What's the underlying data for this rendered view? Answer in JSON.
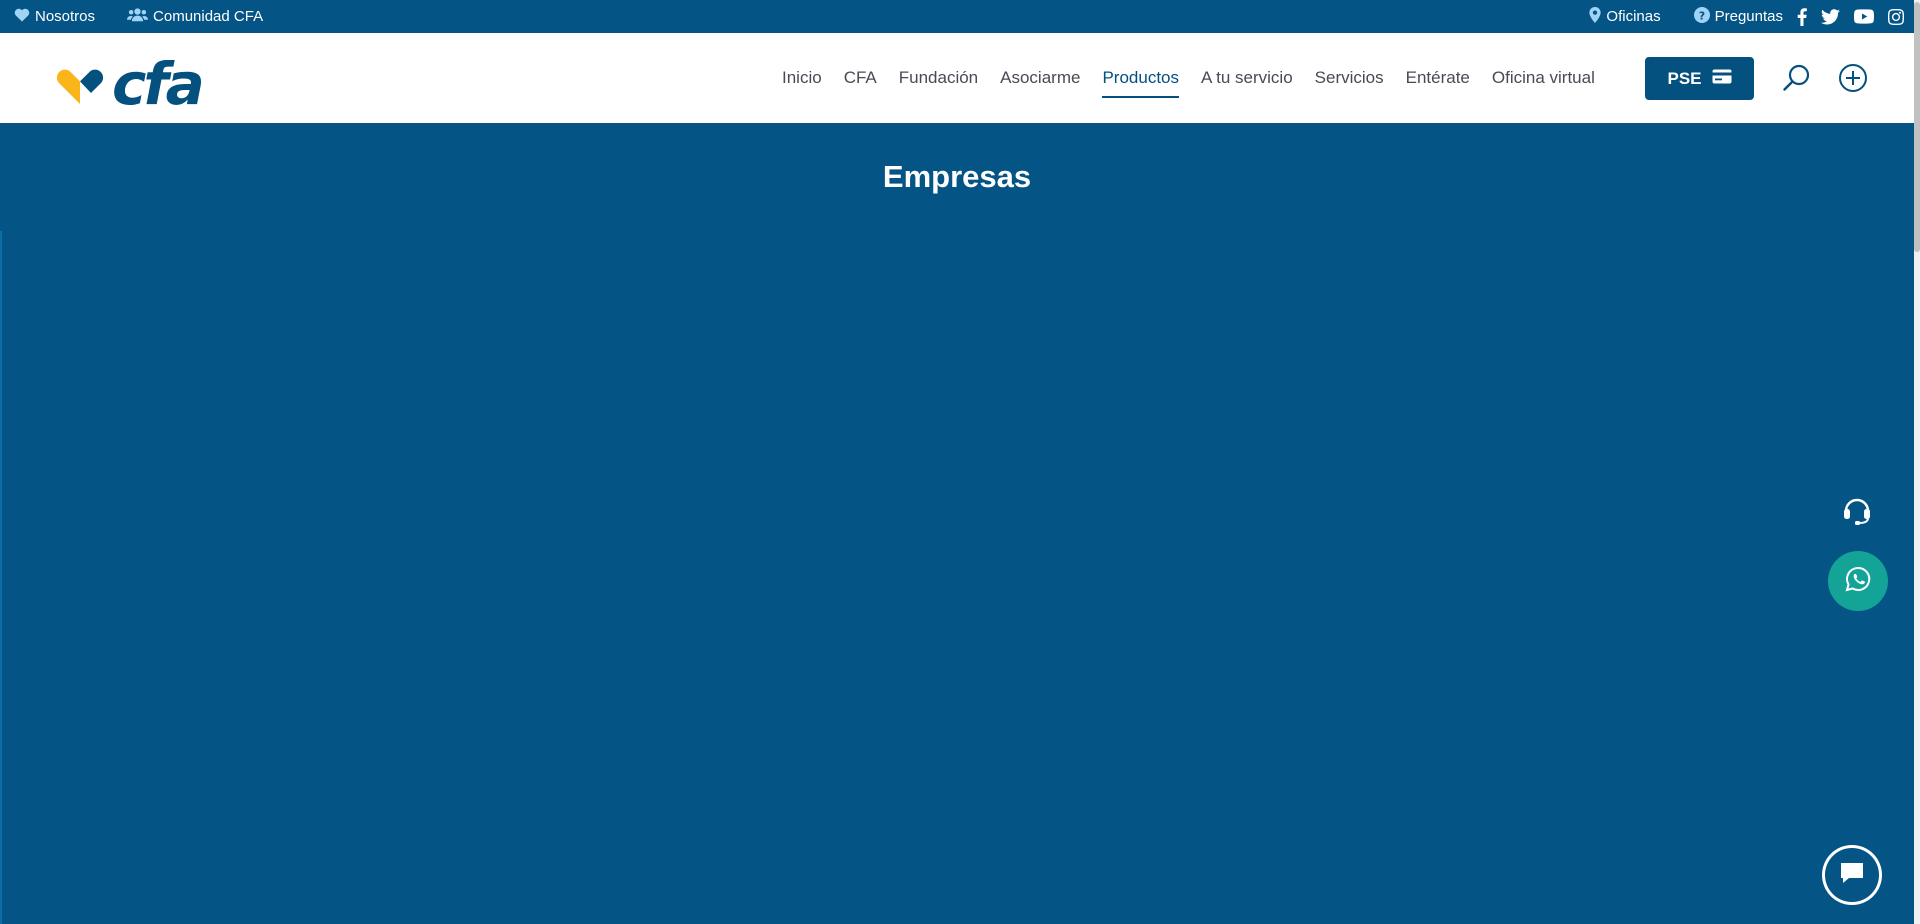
{
  "topbar": {
    "left": [
      {
        "label": "Nosotros",
        "icon": "heart-icon"
      },
      {
        "label": "Comunidad CFA",
        "icon": "users-icon"
      }
    ],
    "right": [
      {
        "label": "Oficinas",
        "icon": "map-pin-icon"
      },
      {
        "label": "Preguntas",
        "icon": "question-circle-icon"
      }
    ],
    "social": [
      "facebook-icon",
      "twitter-icon",
      "youtube-icon",
      "instagram-icon"
    ]
  },
  "logo": {
    "text": "cfa"
  },
  "nav": {
    "items": [
      {
        "label": "Inicio"
      },
      {
        "label": "CFA"
      },
      {
        "label": "Fundación"
      },
      {
        "label": "Asociarme"
      },
      {
        "label": "Productos",
        "active": true
      },
      {
        "label": "A tu servicio"
      },
      {
        "label": "Servicios"
      },
      {
        "label": "Entérate"
      },
      {
        "label": "Oficina virtual"
      }
    ],
    "pse_label": "PSE"
  },
  "hero": {
    "title": "Empresas"
  },
  "colors": {
    "primary": "#045486",
    "nav_active": "#04507f",
    "logo_yellow": "#f9b51a",
    "logo_blue": "#04507f",
    "whatsapp": "#14a397"
  }
}
